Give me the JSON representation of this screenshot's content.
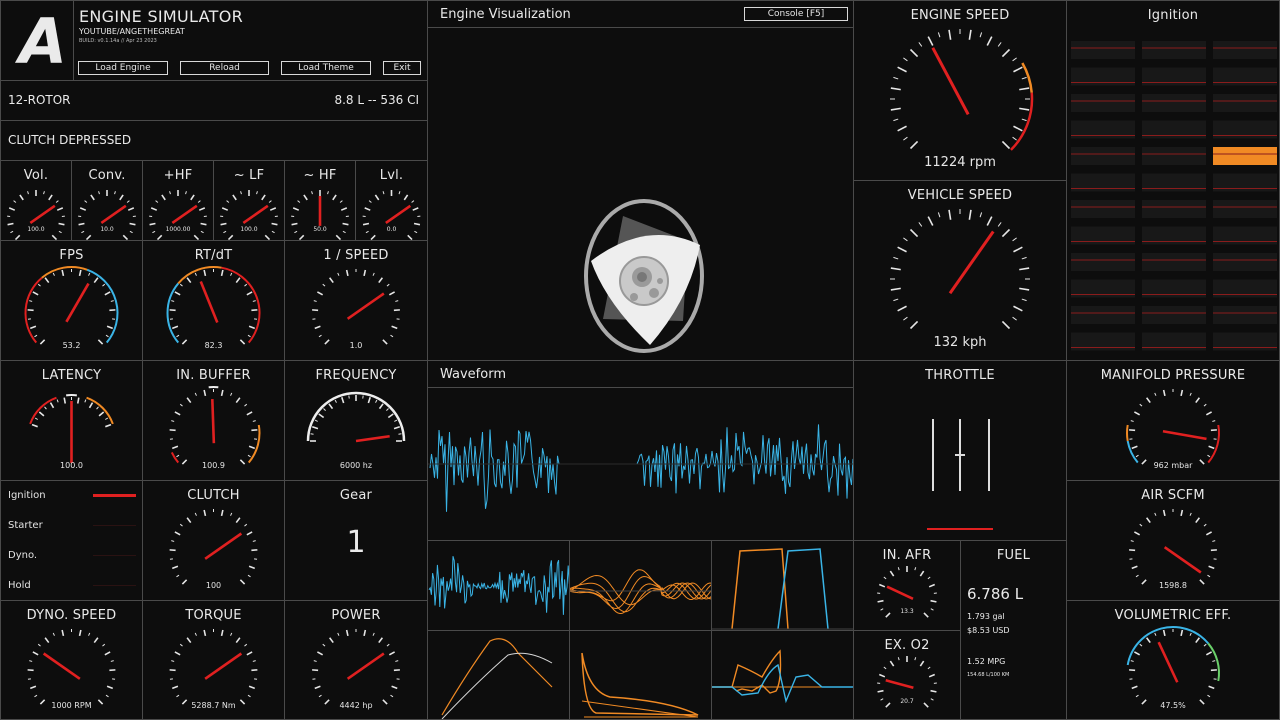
{
  "app": {
    "title": "ENGINE SIMULATOR",
    "subtitle": "YOUTUBE/ANGETHEGREAT",
    "build": "BUILD: v0.1.14a // Apr 23 2023",
    "logo_letter": "A",
    "buttons": {
      "load_engine": "Load Engine",
      "reload": "Reload",
      "load_theme": "Load Theme",
      "exit": "Exit"
    }
  },
  "engine": {
    "name": "12-ROTOR",
    "displacement": "8.8 L -- 536 CI",
    "clutch_status": "CLUTCH DEPRESSED"
  },
  "small_gauges": [
    {
      "label": "Vol.",
      "readout": "100.0",
      "angle": 35
    },
    {
      "label": "Conv.",
      "readout": "10.0",
      "angle": 35
    },
    {
      "label": "+HF",
      "readout": "1000.00",
      "angle": 35
    },
    {
      "label": "~ LF",
      "readout": "100.0",
      "angle": 35
    },
    {
      "label": "~ HF",
      "readout": "50.0",
      "angle": 90
    },
    {
      "label": "Lvl.",
      "readout": "0.0",
      "angle": 35
    }
  ],
  "mid_gauges": {
    "fps": {
      "label": "FPS",
      "readout": "53.2",
      "angle": 60
    },
    "rtdt": {
      "label": "RT/dT",
      "readout": "82.3",
      "angle": 112
    },
    "speed_inv": {
      "label": "1 / SPEED",
      "readout": "1.0",
      "angle": 35
    },
    "latency": {
      "label": "LATENCY",
      "readout": "100.0",
      "angle": 90
    },
    "in_buffer": {
      "label": "IN. BUFFER",
      "readout": "100.9",
      "angle": 92
    },
    "frequency": {
      "label": "FREQUENCY",
      "readout": "6000 hz",
      "angle": 8
    },
    "clutch": {
      "label": "CLUTCH",
      "readout": "100",
      "angle": 35
    },
    "dyno_speed": {
      "label": "DYNO. SPEED",
      "readout": "1000 RPM",
      "angle": 145
    },
    "torque": {
      "label": "TORQUE",
      "readout": "5288.7 Nm",
      "angle": 35
    },
    "power": {
      "label": "POWER",
      "readout": "4442 hp",
      "angle": 35
    },
    "in_afr": {
      "label": "IN. AFR",
      "readout": "13.3",
      "angle": 155
    },
    "ex_o2": {
      "label": "EX. O2",
      "readout": "20.7",
      "angle": 165
    }
  },
  "status_lights": [
    {
      "label": "Ignition",
      "active": true
    },
    {
      "label": "Starter",
      "active": false
    },
    {
      "label": "Dyno.",
      "active": false
    },
    {
      "label": "Hold",
      "active": false
    }
  ],
  "gear": {
    "label": "Gear",
    "value": "1"
  },
  "visualization": {
    "title": "Engine Visualization",
    "console_button": "Console [F5]"
  },
  "waveform": {
    "title": "Waveform"
  },
  "engine_speed": {
    "label": "ENGINE SPEED",
    "readout": "11224 rpm",
    "value": 11224
  },
  "vehicle_speed": {
    "label": "VEHICLE SPEED",
    "readout": "132 kph",
    "value": 132
  },
  "ignition": {
    "title": "Ignition"
  },
  "throttle": {
    "label": "THROTTLE"
  },
  "manifold": {
    "label": "MANIFOLD PRESSURE",
    "readout": "962 mbar"
  },
  "air": {
    "label": "AIR SCFM",
    "readout": "1598.8"
  },
  "vol_eff": {
    "label": "VOLUMETRIC EFF.",
    "readout": "47.5%"
  },
  "fuel": {
    "label": "FUEL",
    "liters": "6.786 L",
    "gallons": "1.793 gal",
    "cost": "$8.53 USD",
    "mpg": "1.52 MPG",
    "per100": "154.68 L/100 KM"
  },
  "colors": {
    "accent_red": "#e02020",
    "accent_orange": "#f08a24",
    "accent_blue": "#3ab4e6",
    "border": "#4a4a4a"
  }
}
